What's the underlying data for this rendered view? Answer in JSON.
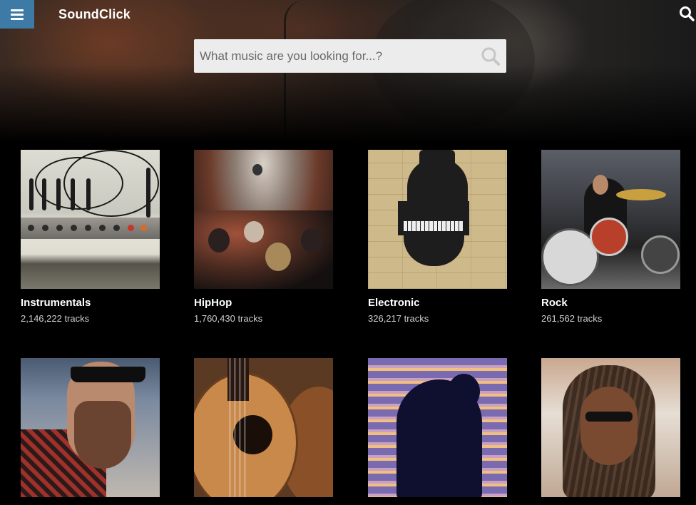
{
  "header": {
    "logo": "SoundClick",
    "menu_icon": "hamburger-menu-icon",
    "search_icon": "search-icon",
    "accent_color": "#3d7aa6"
  },
  "search": {
    "placeholder": "What music are you looking for...?",
    "value": ""
  },
  "genres": [
    {
      "name": "Instrumentals",
      "tracks": "2,146,222 tracks"
    },
    {
      "name": "HipHop",
      "tracks": "1,760,430 tracks"
    },
    {
      "name": "Electronic",
      "tracks": "326,217 tracks"
    },
    {
      "name": "Rock",
      "tracks": "261,562 tracks"
    },
    {
      "name": "",
      "tracks": ""
    },
    {
      "name": "",
      "tracks": ""
    },
    {
      "name": "",
      "tracks": ""
    },
    {
      "name": "",
      "tracks": ""
    }
  ]
}
